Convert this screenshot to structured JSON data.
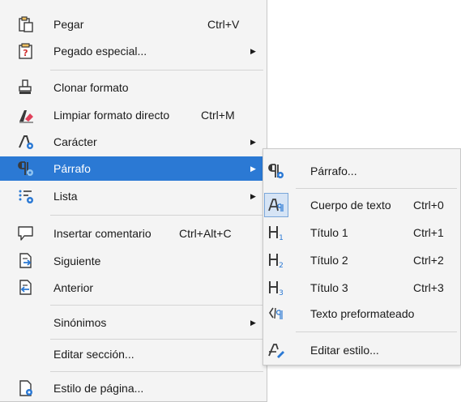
{
  "main_menu": {
    "items": [
      {
        "label": "Pegar",
        "shortcut": "Ctrl+V",
        "icon": "paste-icon"
      },
      {
        "label": "Pegado especial...",
        "icon": "paste-special-icon"
      },
      {
        "label": "Clonar formato",
        "icon": "clone-formatting-icon"
      },
      {
        "label": "Limpiar formato directo",
        "shortcut": "Ctrl+M",
        "icon": "clear-formatting-icon"
      },
      {
        "label": "Carácter",
        "icon": "character-icon"
      },
      {
        "label": "Párrafo",
        "icon": "paragraph-icon"
      },
      {
        "label": "Lista",
        "icon": "list-icon"
      },
      {
        "label": "Insertar comentario",
        "shortcut": "Ctrl+Alt+C",
        "icon": "comment-icon"
      },
      {
        "label": "Siguiente",
        "icon": "next-icon"
      },
      {
        "label": "Anterior",
        "icon": "previous-icon"
      },
      {
        "label": "Sinónimos",
        "icon": ""
      },
      {
        "label": "Editar sección...",
        "icon": ""
      },
      {
        "label": "Estilo de página...",
        "icon": "page-style-icon"
      }
    ]
  },
  "sub_menu": {
    "items": [
      {
        "label": "Párrafo...",
        "icon": "paragraph-dialog-icon"
      },
      {
        "label": "Cuerpo de texto",
        "shortcut": "Ctrl+0",
        "icon": "text-body-icon"
      },
      {
        "label": "Título 1",
        "shortcut": "Ctrl+1",
        "icon": "heading-1-icon"
      },
      {
        "label": "Título 2",
        "shortcut": "Ctrl+2",
        "icon": "heading-2-icon"
      },
      {
        "label": "Título 3",
        "shortcut": "Ctrl+3",
        "icon": "heading-3-icon"
      },
      {
        "label": "Texto preformateado",
        "icon": "preformatted-text-icon"
      },
      {
        "label": "Editar estilo...",
        "icon": "edit-style-icon"
      }
    ]
  },
  "colors": {
    "highlight": "#2b79d4",
    "icon_blue": "#2b79d4",
    "icon_dark": "#3a3a3a"
  }
}
